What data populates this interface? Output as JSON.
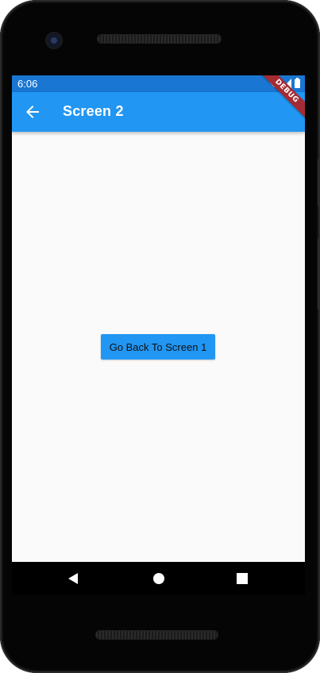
{
  "status_bar": {
    "time": "6:06",
    "background": "#1976d2",
    "icons": [
      "wifi-icon",
      "signal-icon",
      "battery-icon"
    ]
  },
  "app_bar": {
    "title": "Screen 2",
    "background": "#2196f3",
    "back_icon": "arrow-left-icon"
  },
  "debug_banner": {
    "label": "DEBUG",
    "color": "#a42b33"
  },
  "main": {
    "button_label": "Go Back To Screen 1",
    "button_color": "#2196f3",
    "background": "#fafafa"
  },
  "nav_bar": {
    "icons": [
      "nav-back-icon",
      "nav-home-icon",
      "nav-recent-icon"
    ]
  }
}
